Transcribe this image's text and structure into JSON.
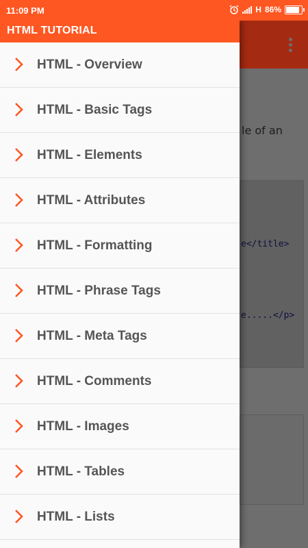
{
  "status_bar": {
    "time": "11:09 PM",
    "network": "H",
    "battery_percent": "86%",
    "battery_level": 0.86
  },
  "drawer": {
    "title": "HTML TUTORIAL",
    "items": [
      {
        "label": "HTML - Overview"
      },
      {
        "label": "HTML - Basic Tags"
      },
      {
        "label": "HTML - Elements"
      },
      {
        "label": "HTML - Attributes"
      },
      {
        "label": "HTML - Formatting"
      },
      {
        "label": "HTML - Phrase Tags"
      },
      {
        "label": "HTML - Meta Tags"
      },
      {
        "label": "HTML - Comments"
      },
      {
        "label": "HTML - Images"
      },
      {
        "label": "HTML - Tables"
      },
      {
        "label": "HTML - Lists"
      }
    ],
    "chevron_icon": "chevron-right-icon",
    "accent_color": "#ff5722"
  },
  "background": {
    "text_fragment": "le of an",
    "code_line_1": "e</title>",
    "code_line_2": "e.....</p>"
  }
}
